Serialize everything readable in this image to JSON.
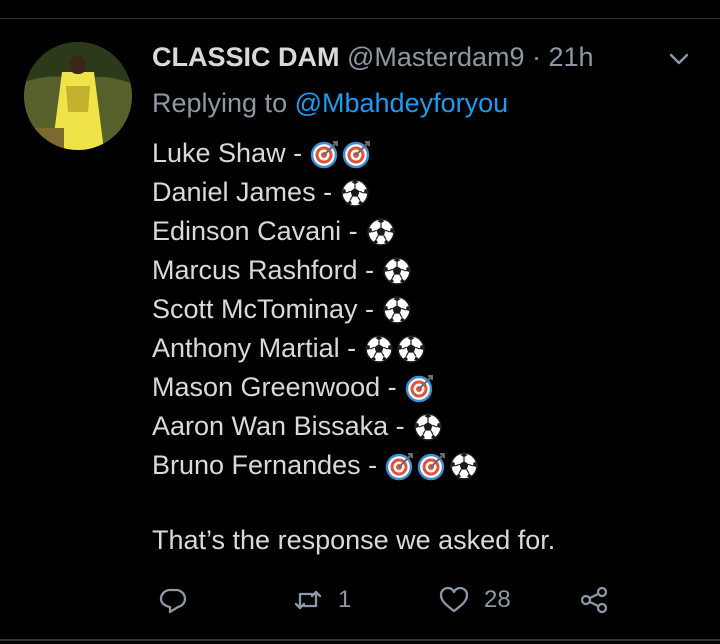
{
  "tweet": {
    "author_name": "CLASSIC DAM",
    "handle": "@Masterdam9",
    "separator": "·",
    "time": "21h",
    "reply_prefix": "Replying to",
    "reply_to": "@Mbahdeyforyou",
    "lines": [
      {
        "text": "Luke Shaw -",
        "emojis": [
          "target-icon",
          "target-icon"
        ]
      },
      {
        "text": "Daniel James -",
        "emojis": [
          "soccer-ball-icon"
        ]
      },
      {
        "text": "Edinson Cavani -",
        "emojis": [
          "soccer-ball-icon"
        ]
      },
      {
        "text": "Marcus Rashford -",
        "emojis": [
          "soccer-ball-icon"
        ]
      },
      {
        "text": "Scott McTominay -",
        "emojis": [
          "soccer-ball-icon"
        ]
      },
      {
        "text": "Anthony Martial -",
        "emojis": [
          "soccer-ball-icon",
          "soccer-ball-icon"
        ]
      },
      {
        "text": "Mason Greenwood -",
        "emojis": [
          "target-icon"
        ]
      },
      {
        "text": "Aaron Wan Bissaka -",
        "emojis": [
          "soccer-ball-icon"
        ]
      },
      {
        "text": "Bruno Fernandes -",
        "emojis": [
          "target-icon",
          "target-icon",
          "soccer-ball-icon"
        ]
      }
    ],
    "closing": "That’s the response we asked for."
  },
  "actions": {
    "reply_icon": "reply-icon",
    "retweet_icon": "retweet-icon",
    "retweet_count": "1",
    "like_icon": "heart-icon",
    "like_count": "28",
    "share_icon": "share-icon"
  },
  "colors": {
    "background": "#000000",
    "text": "#d9d9d9",
    "muted": "#8b98a5",
    "mention": "#1d9bf0",
    "target_red": "#e0523a",
    "target_blue": "#3b8fd6"
  }
}
